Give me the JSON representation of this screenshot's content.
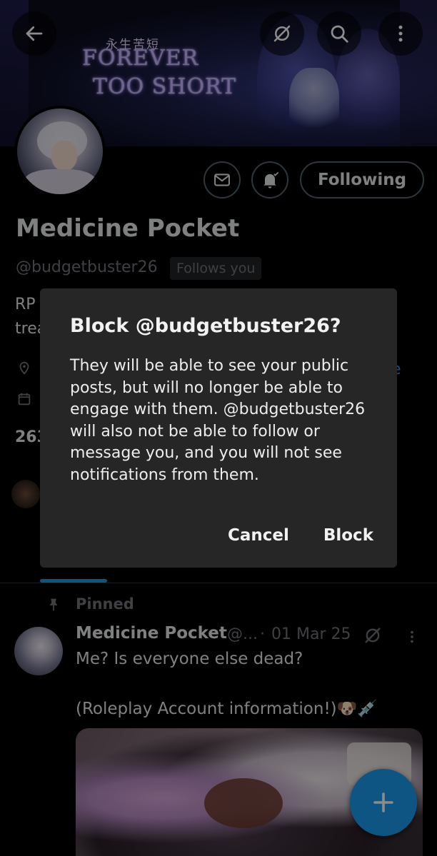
{
  "banner": {
    "logo_cn": "永生苦短",
    "logo_line1": "FOREVER",
    "logo_line2": "TOO SHORT"
  },
  "top_bar": {
    "back_icon": "arrow-left-icon",
    "grok_icon": "slash-circle-icon",
    "search_icon": "search-icon",
    "more_icon": "more-vertical-icon"
  },
  "profile": {
    "name": "Medicine Pocket",
    "handle": "@budgetbuster26",
    "follows_you": "Follows you",
    "following_label": "Following",
    "bio_fragment_1": "RP",
    "bio_fragment_2": "trea",
    "link_fragment": "e",
    "count_fragment": "263"
  },
  "post": {
    "pinned_label": "Pinned",
    "author": "Medicine Pocket",
    "handle": "@...",
    "dot": "·",
    "date": "01 Mar 25",
    "text_line1": "Me? Is everyone else dead?",
    "text_line2": "(Roleplay Account information!)🐶💉"
  },
  "dialog": {
    "title": "Block @budgetbuster26?",
    "body": "They will be able to see your public posts, but will no longer be able to engage with them. @budgetbuster26 will also not be able to follow or message you, and you will not see notifications from them.",
    "cancel": "Cancel",
    "block": "Block"
  },
  "colors": {
    "accent": "#1d9bf0",
    "dialog_bg": "#262626",
    "muted": "#71767b"
  }
}
